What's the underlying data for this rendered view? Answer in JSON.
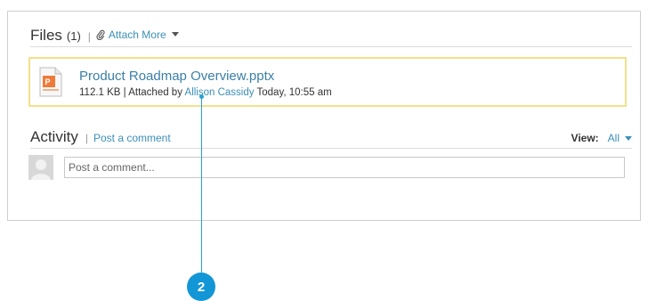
{
  "files": {
    "title": "Files",
    "count": "(1)",
    "separator": "|",
    "attach_more": "Attach More",
    "item": {
      "icon": "powerpoint-file-icon",
      "name": "Product Roadmap Overview.pptx",
      "size": "112.1 KB",
      "attached_by_prefix": "| Attached by",
      "attached_by_user": "Allison Cassidy",
      "timestamp": "Today, 10:55 am"
    }
  },
  "activity": {
    "title": "Activity",
    "separator": "|",
    "post_comment": "Post a comment",
    "view_label": "View:",
    "view_value": "All",
    "comment_placeholder": "Post a comment..."
  },
  "callout": {
    "number": "2"
  },
  "colors": {
    "link": "#3b8fb8",
    "highlight_border": "#f4e08a",
    "callout": "#1296d6"
  }
}
